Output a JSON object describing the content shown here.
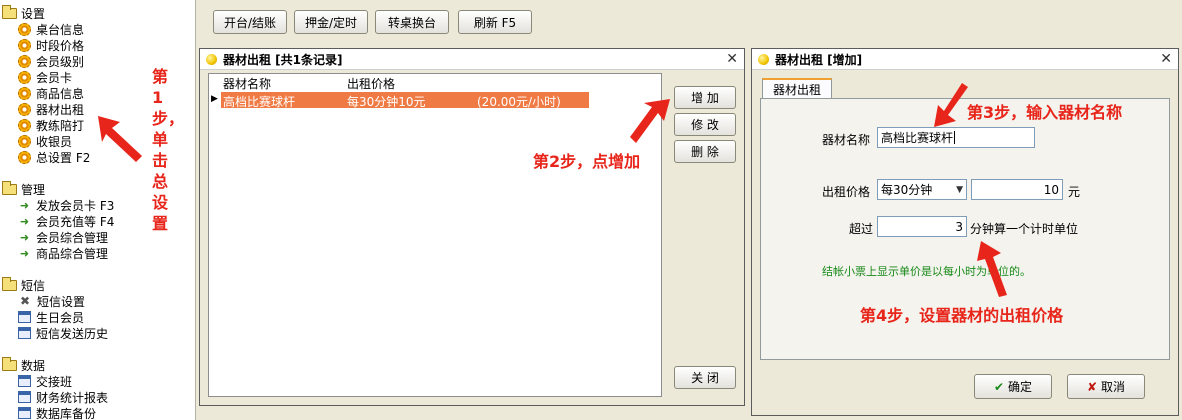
{
  "sidebar": {
    "groups": [
      {
        "label": "设置",
        "items": [
          {
            "label": "桌台信息",
            "icon": "gear-icon"
          },
          {
            "label": "时段价格",
            "icon": "gear-icon"
          },
          {
            "label": "会员级别",
            "icon": "gear-icon"
          },
          {
            "label": "会员卡",
            "icon": "gear-icon"
          },
          {
            "label": "商品信息",
            "icon": "gear-icon"
          },
          {
            "label": "器材出租",
            "icon": "gear-icon"
          },
          {
            "label": "教练陪打",
            "icon": "gear-icon"
          },
          {
            "label": "收银员",
            "icon": "gear-icon"
          },
          {
            "label": "总设置 F2",
            "icon": "gear-icon"
          }
        ]
      },
      {
        "label": "管理",
        "items": [
          {
            "label": "发放会员卡 F3",
            "icon": "green-arrow-icon"
          },
          {
            "label": "会员充值等 F4",
            "icon": "green-arrow-icon"
          },
          {
            "label": "会员综合管理",
            "icon": "green-arrow-icon"
          },
          {
            "label": "商品综合管理",
            "icon": "green-arrow-icon"
          }
        ]
      },
      {
        "label": "短信",
        "items": [
          {
            "label": "短信设置",
            "icon": "tools-icon"
          },
          {
            "label": "生日会员",
            "icon": "window-icon"
          },
          {
            "label": "短信发送历史",
            "icon": "window-icon"
          }
        ]
      },
      {
        "label": "数据",
        "items": [
          {
            "label": "交接班",
            "icon": "window-icon"
          },
          {
            "label": "财务统计报表",
            "icon": "window-icon"
          },
          {
            "label": "数据库备份",
            "icon": "window-icon"
          }
        ]
      }
    ]
  },
  "annotations": {
    "step1": "第1步，单击总设置",
    "step2": "第2步，点增加",
    "step3": "第3步，输入器材名称",
    "step4": "第4步，设置器材的出租价格"
  },
  "toolbar": {
    "open_close": "开台/结账",
    "deposit_timer": "押金/定时",
    "transfer_table": "转桌换台",
    "refresh": "刷新 F5"
  },
  "list_dialog": {
    "title": "器材出租 [共1条记录]",
    "columns": [
      "器材名称",
      "出租价格"
    ],
    "rows": [
      {
        "name": "高档比赛球杆",
        "price": "每30分钟10元",
        "rate": "(20.00元/小时)"
      }
    ],
    "buttons": {
      "add": "增 加",
      "edit": "修 改",
      "delete": "删 除",
      "close": "关 闭"
    }
  },
  "add_dialog": {
    "title": "器材出租 [增加]",
    "tab": "器材出租",
    "name_label": "器材名称",
    "name_value": "高档比赛球杆",
    "price_label": "出租价格",
    "period_option": "每30分钟",
    "price_value": "10",
    "price_unit": "元",
    "exceed_label": "超过",
    "exceed_value": "3",
    "exceed_suffix": "分钟算一个计时单位",
    "note": "结帐小票上显示单价是以每小时为单位的。",
    "ok": "确定",
    "cancel": "取消"
  },
  "colors": {
    "selected_row": "#f07a43",
    "annotation": "#e8251a",
    "note": "#178a17"
  }
}
